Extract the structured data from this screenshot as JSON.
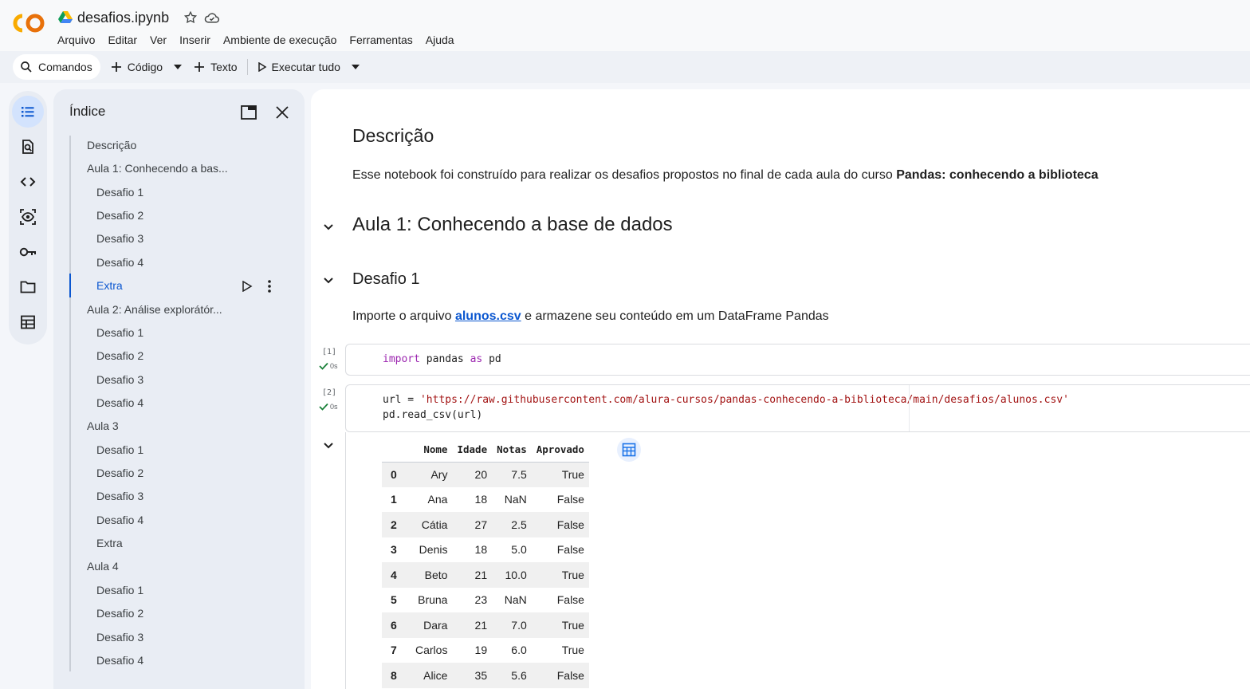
{
  "header": {
    "title": "desafios.ipynb",
    "menu": [
      "Arquivo",
      "Editar",
      "Ver",
      "Inserir",
      "Ambiente de execução",
      "Ferramentas",
      "Ajuda"
    ]
  },
  "toolbar": {
    "commands": "Comandos",
    "code": "Código",
    "text": "Texto",
    "run_all": "Executar tudo"
  },
  "toc": {
    "title": "Índice",
    "items": [
      {
        "label": "Descrição",
        "level": 1
      },
      {
        "label": "Aula 1: Conhecendo a bas...",
        "level": 1
      },
      {
        "label": "Desafio 1",
        "level": 2
      },
      {
        "label": "Desafio 2",
        "level": 2
      },
      {
        "label": "Desafio 3",
        "level": 2
      },
      {
        "label": "Desafio 4",
        "level": 2
      },
      {
        "label": "Extra",
        "level": 2,
        "active": true
      },
      {
        "label": "Aula 2: Análise explorátór...",
        "level": 1
      },
      {
        "label": "Desafio 1",
        "level": 2
      },
      {
        "label": "Desafio 2",
        "level": 2
      },
      {
        "label": "Desafio 3",
        "level": 2
      },
      {
        "label": "Desafio 4",
        "level": 2
      },
      {
        "label": "Aula 3",
        "level": 1
      },
      {
        "label": "Desafio 1",
        "level": 2
      },
      {
        "label": "Desafio 2",
        "level": 2
      },
      {
        "label": "Desafio 3",
        "level": 2
      },
      {
        "label": "Desafio 4",
        "level": 2
      },
      {
        "label": "Extra",
        "level": 2
      },
      {
        "label": "Aula 4",
        "level": 1
      },
      {
        "label": "Desafio 1",
        "level": 2
      },
      {
        "label": "Desafio 2",
        "level": 2
      },
      {
        "label": "Desafio 3",
        "level": 2
      },
      {
        "label": "Desafio 4",
        "level": 2
      }
    ]
  },
  "notebook": {
    "desc_heading": "Descrição",
    "desc_text": "Esse notebook foi construído para realizar os desafios propostos no final de cada aula do curso ",
    "desc_bold": "Pandas: conhecendo a biblioteca",
    "aula1_heading": "Aula 1: Conhecendo a base de dados",
    "desafio1_heading": "Desafio 1",
    "import_prefix": "Importe o arquivo ",
    "import_link": "alunos.csv",
    "import_suffix": " e armazene seu conteúdo em um DataFrame Pandas",
    "cell1": {
      "count": "[1]",
      "status": "0s",
      "kw_import": "import",
      "module": " pandas ",
      "kw_as": "as",
      "alias": " pd"
    },
    "cell2": {
      "count": "[2]",
      "status": "0s",
      "line1_prefix": "url = ",
      "line1_url": "'https://raw.githubusercontent.com/alura-cursos/pandas-conhecendo-a-biblioteca/main/desafios/alunos.csv'",
      "line2": "pd.read_csv(url)"
    },
    "table": {
      "columns": [
        "Nome",
        "Idade",
        "Notas",
        "Aprovado"
      ],
      "rows": [
        [
          "0",
          "Ary",
          "20",
          "7.5",
          "True"
        ],
        [
          "1",
          "Ana",
          "18",
          "NaN",
          "False"
        ],
        [
          "2",
          "Cátia",
          "27",
          "2.5",
          "False"
        ],
        [
          "3",
          "Denis",
          "18",
          "5.0",
          "False"
        ],
        [
          "4",
          "Beto",
          "21",
          "10.0",
          "True"
        ],
        [
          "5",
          "Bruna",
          "23",
          "NaN",
          "False"
        ],
        [
          "6",
          "Dara",
          "21",
          "7.0",
          "True"
        ],
        [
          "7",
          "Carlos",
          "19",
          "6.0",
          "True"
        ],
        [
          "8",
          "Alice",
          "35",
          "5.6",
          "False"
        ]
      ]
    }
  }
}
